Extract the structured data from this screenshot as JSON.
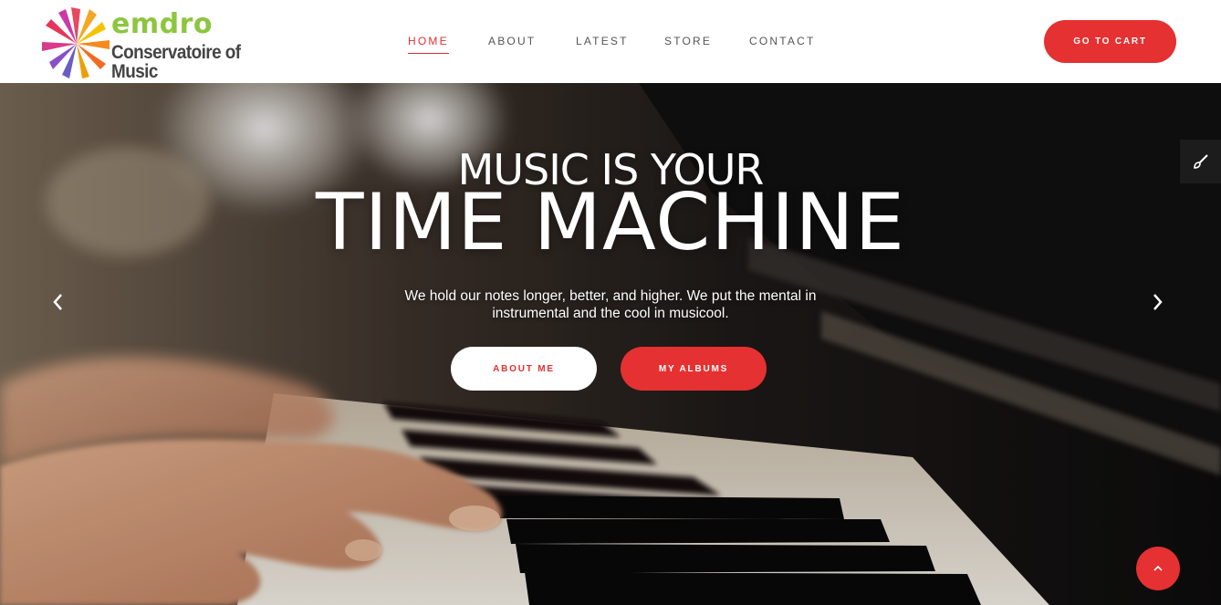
{
  "logo": {
    "name": "emdro",
    "subtitle": "Conservatoire of Music"
  },
  "nav": {
    "items": [
      {
        "label": "HOME",
        "active": true
      },
      {
        "label": "ABOUT",
        "active": false
      },
      {
        "label": "LATEST",
        "active": false
      },
      {
        "label": "STORE",
        "active": false
      },
      {
        "label": "CONTACT",
        "active": false
      }
    ]
  },
  "header": {
    "cart_label": "GO TO CART"
  },
  "hero": {
    "title_line1": "MUSIC IS YOUR",
    "title_line2": "TIME MACHINE",
    "description": "We hold our notes longer, better, and higher. We put the mental in instrumental and the cool in musicool.",
    "about_label": "ABOUT ME",
    "albums_label": "MY ALBUMS",
    "prev_icon": "chevron-left-icon",
    "next_icon": "chevron-right-icon"
  },
  "tools": {
    "side_icon": "brush-icon",
    "scroll_top_icon": "chevron-up-icon"
  },
  "colors": {
    "accent": "#e53131",
    "logo_green": "#8cc63f",
    "logo_text": "#444444",
    "nav_text": "#555555"
  }
}
